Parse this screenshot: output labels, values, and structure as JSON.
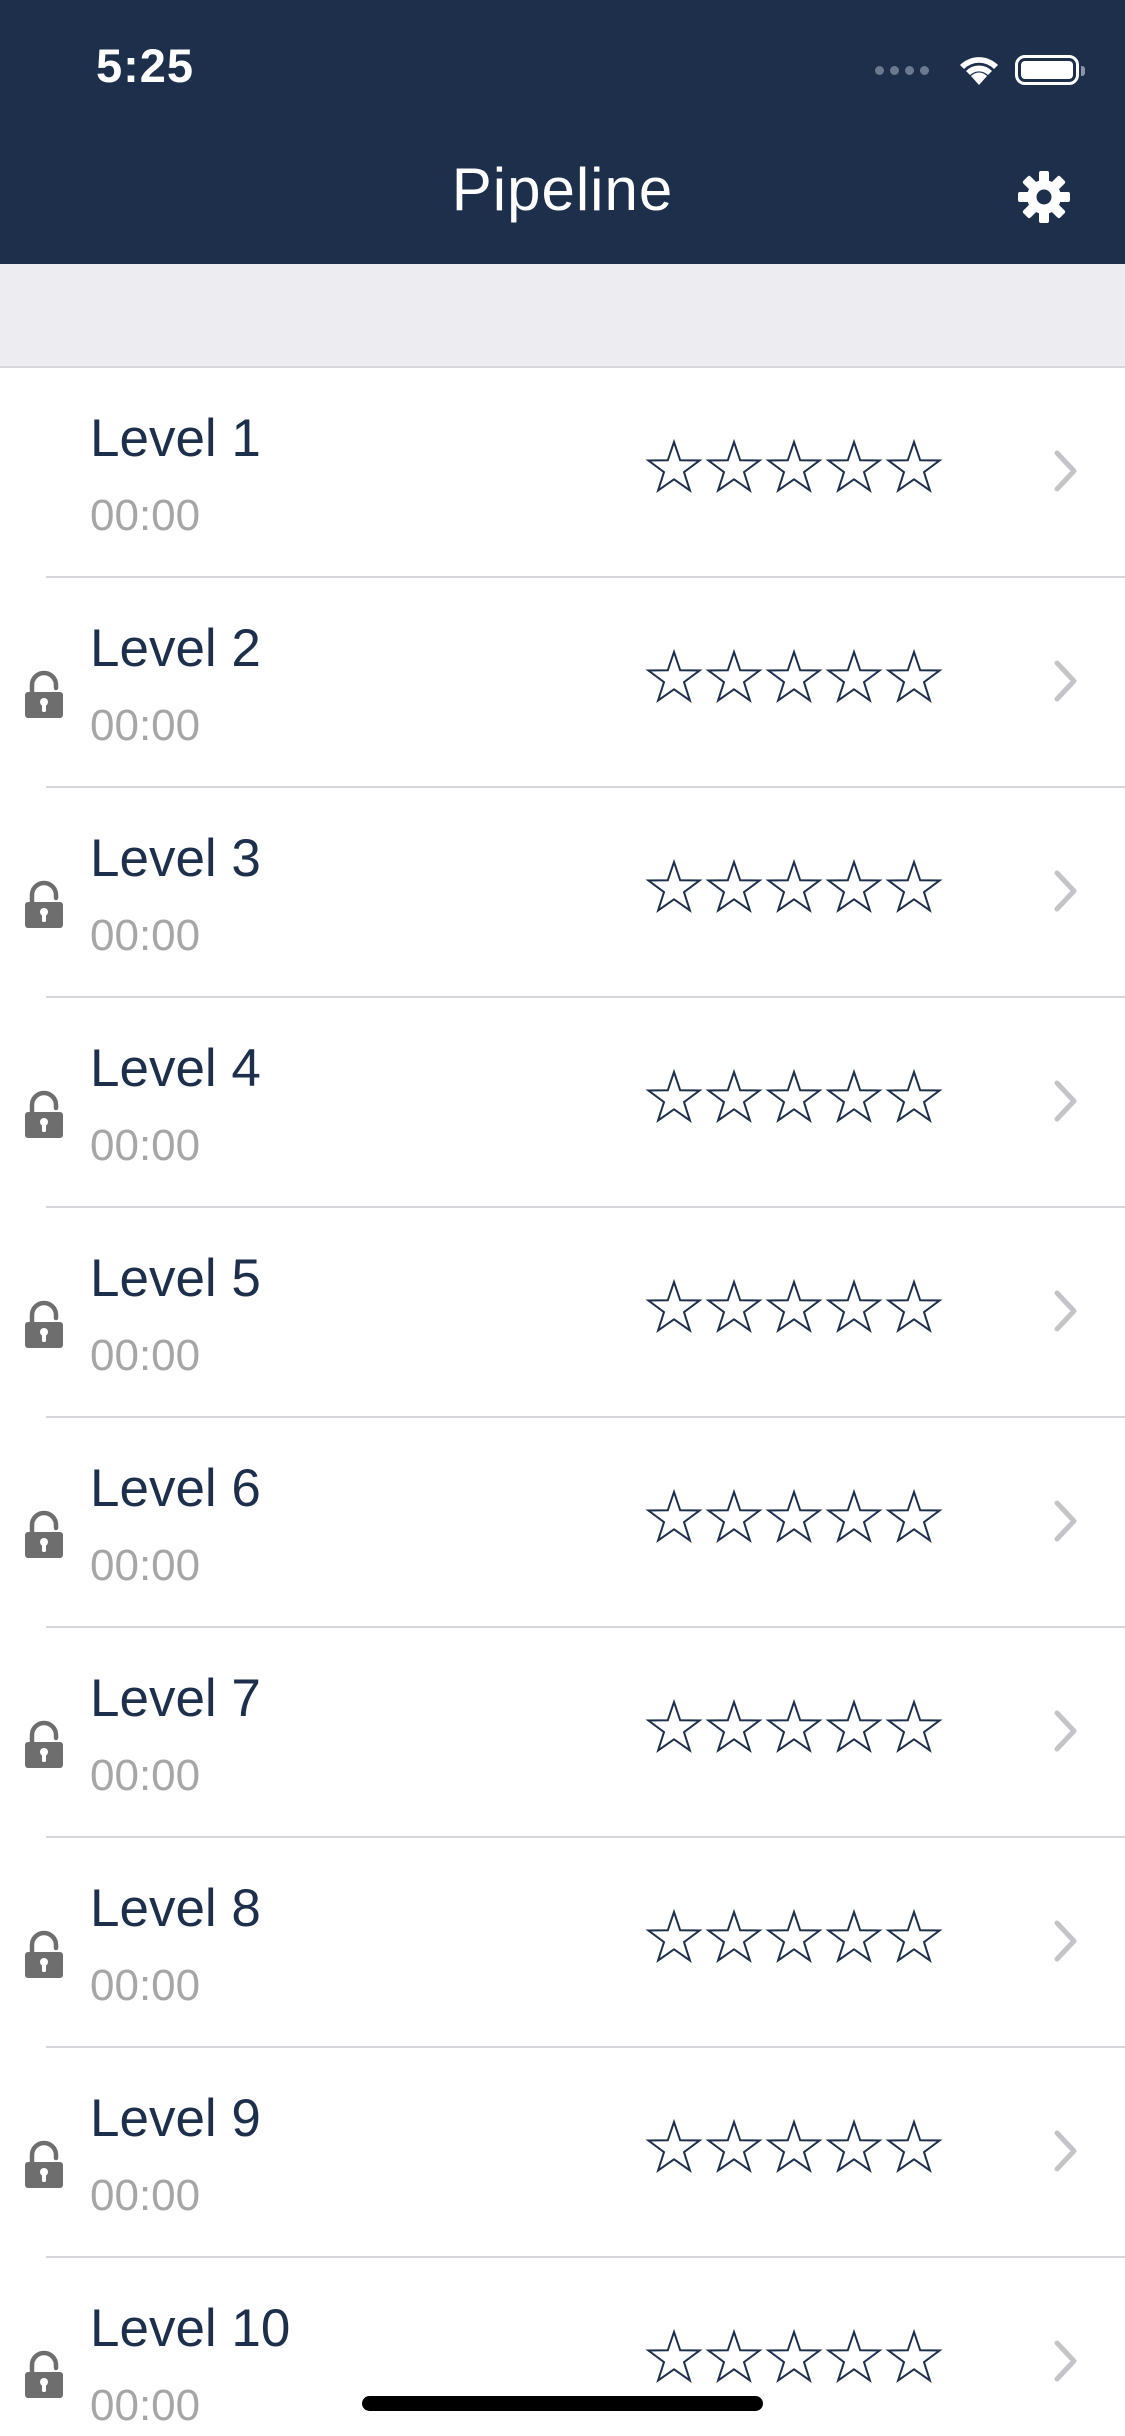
{
  "status_bar": {
    "time": "5:25"
  },
  "nav": {
    "title": "Pipeline"
  },
  "levels": [
    {
      "title": "Level 1",
      "time": "00:00",
      "locked": false,
      "stars": 0
    },
    {
      "title": "Level 2",
      "time": "00:00",
      "locked": true,
      "stars": 0
    },
    {
      "title": "Level 3",
      "time": "00:00",
      "locked": true,
      "stars": 0
    },
    {
      "title": "Level 4",
      "time": "00:00",
      "locked": true,
      "stars": 0
    },
    {
      "title": "Level 5",
      "time": "00:00",
      "locked": true,
      "stars": 0
    },
    {
      "title": "Level 6",
      "time": "00:00",
      "locked": true,
      "stars": 0
    },
    {
      "title": "Level 7",
      "time": "00:00",
      "locked": true,
      "stars": 0
    },
    {
      "title": "Level 8",
      "time": "00:00",
      "locked": true,
      "stars": 0
    },
    {
      "title": "Level 9",
      "time": "00:00",
      "locked": true,
      "stars": 0
    },
    {
      "title": "Level 10",
      "time": "00:00",
      "locked": true,
      "stars": 0
    }
  ],
  "max_stars": 5,
  "icons": {
    "settings": "gear-icon",
    "lock": "lock-icon",
    "star": "star-outline-icon",
    "chevron": "chevron-right-icon",
    "wifi": "wifi-icon",
    "battery": "battery-icon"
  },
  "colors": {
    "header_background": "#1d2f4b",
    "title_text": "#1d2f4b",
    "time_text": "#a6a6a6",
    "section_background": "#ececf1",
    "lock": "#6e6e6e",
    "chevron": "#c4c4c8"
  }
}
